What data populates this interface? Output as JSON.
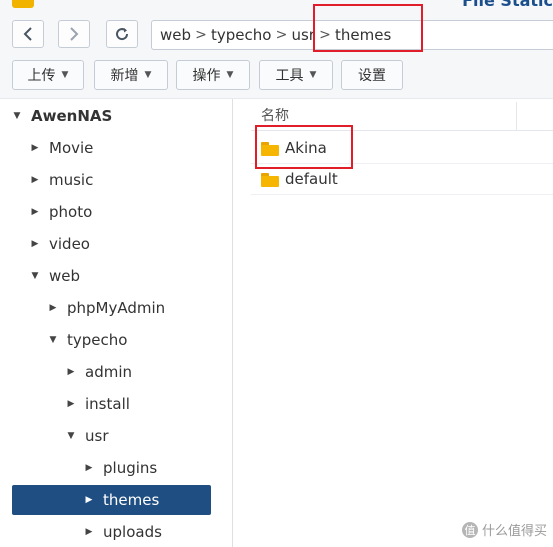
{
  "app": {
    "title": "File Static"
  },
  "nav": {
    "back_icon": "chevron-left",
    "forward_icon": "chevron-right",
    "refresh_icon": "refresh",
    "breadcrumb": [
      "web",
      "typecho",
      "usr",
      "themes"
    ]
  },
  "toolbar": {
    "upload_label": "上传",
    "new_label": "新增",
    "action_label": "操作",
    "tools_label": "工具",
    "settings_label": "设置"
  },
  "tree": {
    "root": "AwenNAS",
    "movie": "Movie",
    "music": "music",
    "photo": "photo",
    "video": "video",
    "web": "web",
    "phpmyadmin": "phpMyAdmin",
    "typecho": "typecho",
    "admin": "admin",
    "install": "install",
    "usr": "usr",
    "plugins": "plugins",
    "themes": "themes",
    "uploads": "uploads"
  },
  "content": {
    "column_name": "名称",
    "files": [
      {
        "name": "Akina",
        "icon": "folder-icon"
      },
      {
        "name": "default",
        "icon": "folder-icon"
      }
    ]
  },
  "watermark": {
    "badge": "值",
    "text": "什么值得买"
  },
  "colors": {
    "accent": "#1f4f82",
    "highlight_box": "#e11d2a",
    "folder": "#f6b600"
  }
}
